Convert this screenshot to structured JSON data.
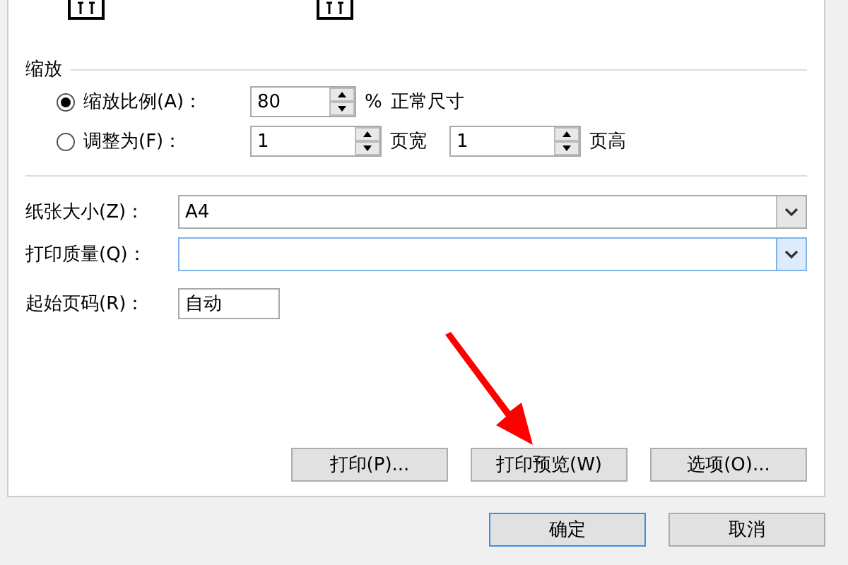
{
  "scaling": {
    "heading": "缩放",
    "options": [
      {
        "label": "缩放比例(A)：",
        "selected": true,
        "kind": "percent",
        "value": "80",
        "unit": "%",
        "note": "正常尺寸"
      },
      {
        "label": "调整为(F)：",
        "selected": false,
        "kind": "fit",
        "value": "1",
        "unit": "页宽",
        "value_2": "1",
        "unit_2": "页高"
      }
    ]
  },
  "paper_size": {
    "label": "纸张大小(Z)：",
    "value": "A4"
  },
  "print_quality": {
    "label": "打印质量(Q)：",
    "focused": true
  },
  "first_page": {
    "label": "起始页码(R)：",
    "value": "自动"
  },
  "actions": [
    "打印(P)...",
    "打印预览(W)",
    "选项(O)..."
  ],
  "footer": [
    {
      "label": "确定",
      "default": true
    },
    {
      "label": "取消",
      "default": false
    }
  ]
}
